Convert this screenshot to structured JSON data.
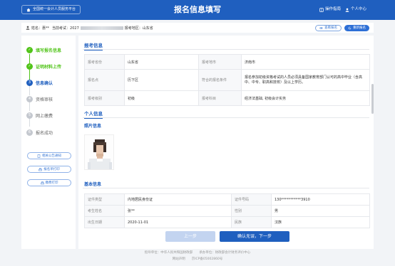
{
  "header": {
    "platform_label": "全国统一会计人员服务平台",
    "title": "报名信息填写",
    "guide": "操作指南",
    "user_center": "个人中心"
  },
  "infobar": {
    "name_prefix": "姓名：",
    "name": "惠**",
    "exam_prefix": "当前考试：2027",
    "region_prefix": "报考地区：",
    "region": "山东省",
    "btn_view": "查看报名",
    "btn_reset": "重新报名"
  },
  "steps": [
    {
      "label": "填写报名信息",
      "num": "✓",
      "state": "done"
    },
    {
      "label": "证明材料上传",
      "num": "✓",
      "state": "done"
    },
    {
      "label": "信息确认",
      "num": "3",
      "state": "active"
    },
    {
      "label": "资格审核",
      "num": "4",
      "state": "todo"
    },
    {
      "label": "网上缴费",
      "num": "5",
      "state": "todo"
    },
    {
      "label": "报名成功",
      "num": "6",
      "state": "todo"
    }
  ],
  "side_buttons": [
    "相关公告通知",
    "报名单打印",
    "缴费打印"
  ],
  "sections": {
    "exam_info": "报考信息",
    "personal_info": "个人信息",
    "photo_info": "照片信息",
    "basic_info": "基本信息"
  },
  "exam_table": [
    {
      "k1": "报考省份",
      "v1": "山东省",
      "k2": "报考地市",
      "v2": "济南市"
    },
    {
      "k1": "报名点",
      "v1": "历下区",
      "k2": "符合的报名条件",
      "v2": "报名参加初级资格考试的人员必须具备国家教育部门认可的高中毕业（含高中、中专、职高和技校）及以上学历。"
    },
    {
      "k1": "报考级别",
      "v1": "初级",
      "k2": "报考科目",
      "v2": "经济法基础, 初级会计实务"
    }
  ],
  "basic_table": [
    {
      "k1": "证件类型",
      "v1": "内地居民身份证",
      "k2": "证件号码",
      "v2": "130***********3910"
    },
    {
      "k1": "考生姓名",
      "v1": "张**",
      "k2": "性别",
      "v2": "男"
    },
    {
      "k1": "出生日期",
      "v1": "2020-11-01",
      "k2": "民族",
      "v2": "汉族"
    }
  ],
  "actions": {
    "prev": "上一步",
    "next": "确认无误，下一步"
  },
  "footer": {
    "line1": "指导单位：中华人民共和国财政部　　承办单位：财政部会计财务评价中心",
    "line2": "网站声明　　京ICP备05002860号"
  },
  "colors": {
    "brand": "#1f5fbf",
    "done": "#52c41a"
  }
}
